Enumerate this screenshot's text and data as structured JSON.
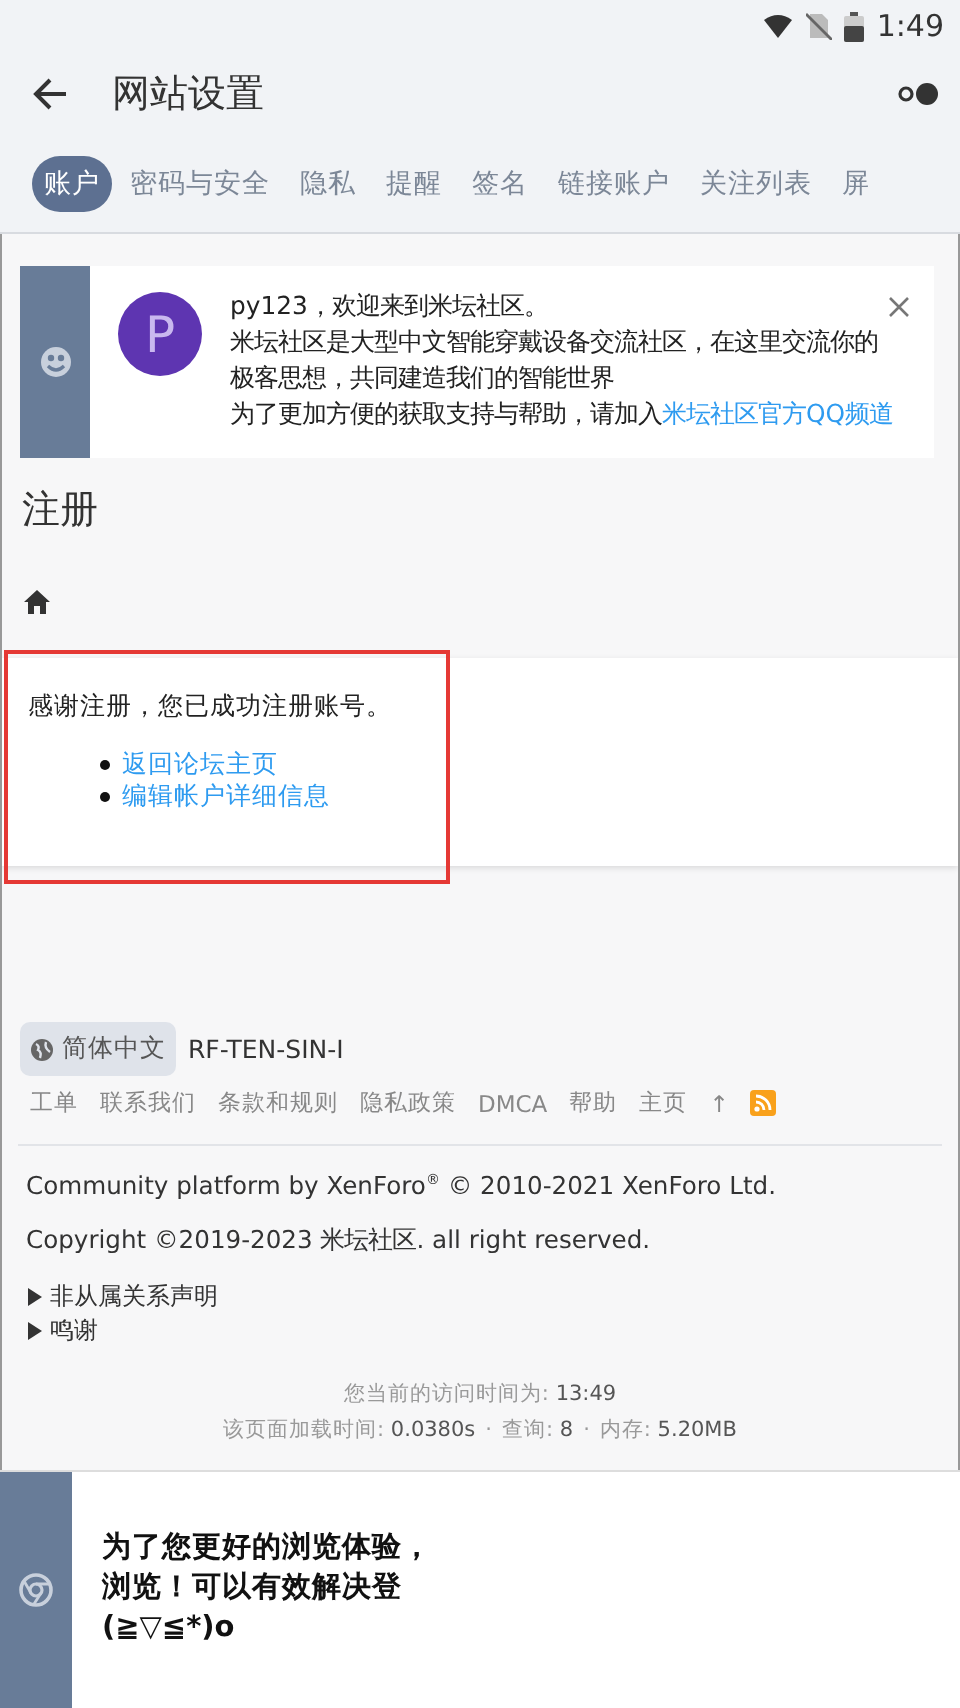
{
  "status_bar": {
    "time": "1:49"
  },
  "app_bar": {
    "title": "网站设置"
  },
  "tabs": [
    {
      "label": "账户",
      "selected": true
    },
    {
      "label": "密码与安全",
      "selected": false
    },
    {
      "label": "隐私",
      "selected": false
    },
    {
      "label": "提醒",
      "selected": false
    },
    {
      "label": "签名",
      "selected": false
    },
    {
      "label": "链接账户",
      "selected": false
    },
    {
      "label": "关注列表",
      "selected": false
    },
    {
      "label": "屏",
      "selected": false
    }
  ],
  "notice": {
    "avatar_letter": "P",
    "greeting": "py123，欢迎来到米坛社区。",
    "description": "米坛社区是大型中文智能穿戴设备交流社区，在这里交流你的极客思想，共同建造我们的智能世界",
    "join_text": "为了更加方便的获取支持与帮助，请加入",
    "join_link": "米坛社区官方QQ频道"
  },
  "page_title": "注册",
  "message": {
    "text": "感谢注册，您已成功注册账号。",
    "links": [
      "返回论坛主页",
      "编辑帐户详细信息"
    ]
  },
  "footer": {
    "language": "简体中文",
    "style": "RF-TEN-SIN-I",
    "links": [
      "工单",
      "联系我们",
      "条款和规则",
      "隐私政策",
      "DMCA",
      "帮助",
      "主页",
      "↑"
    ],
    "credit": "Community platform by XenForo$^{®}$ © 2010-2021 XenForo Ltd.",
    "copyright": "Copyright ©2019-2023 米坛社区. all right reserved.",
    "details": [
      {
        "label": "非从属关系声明",
        "expanded": false
      },
      {
        "label": "鸣谢",
        "expanded": false
      }
    ],
    "stats": [
      [
        {
          "label": "您当前的访问时间为:",
          "value": "13:49"
        }
      ],
      [
        {
          "label": "该页面加载时间:",
          "value": "0.0380s"
        },
        {
          "label": "查询:",
          "value": "8"
        },
        {
          "label": "内存:",
          "value": "5.20MB"
        }
      ]
    ],
    "separator": "·"
  },
  "banner": {
    "lines": [
      "为了您更好的浏览体验，",
      "浏览！可以有效解决登",
      "(≧▽≦*)o"
    ]
  }
}
